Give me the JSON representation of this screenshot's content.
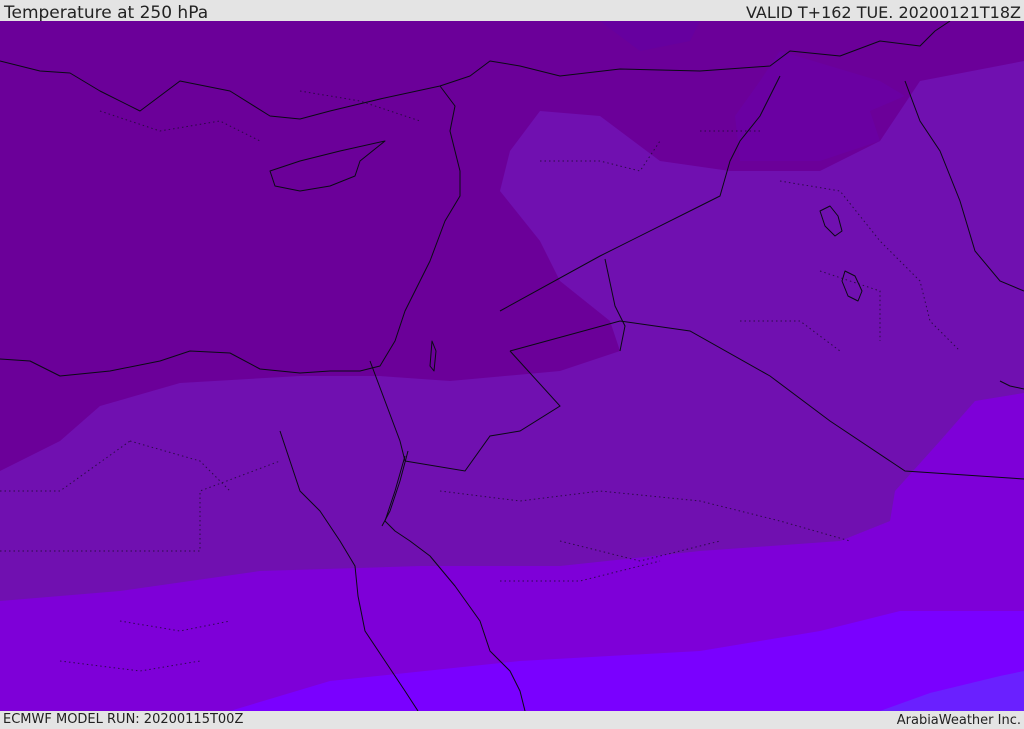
{
  "header": {
    "title": "Temperature at 250 hPa",
    "valid": "VALID T+162 TUE. 20200121T18Z"
  },
  "footer": {
    "model_run": "ECMWF MODEL RUN: 20200115T00Z",
    "credit": "ArabiaWeather Inc."
  },
  "colors": {
    "band_darkest": "#6a0099",
    "band_dark": "#6f00a4",
    "band_mid": "#7610b4",
    "band_purple": "#7e00d8",
    "band_violet": "#7a00ff",
    "band_blue_violet": "#6a20ff",
    "line": "#0a0a14"
  }
}
